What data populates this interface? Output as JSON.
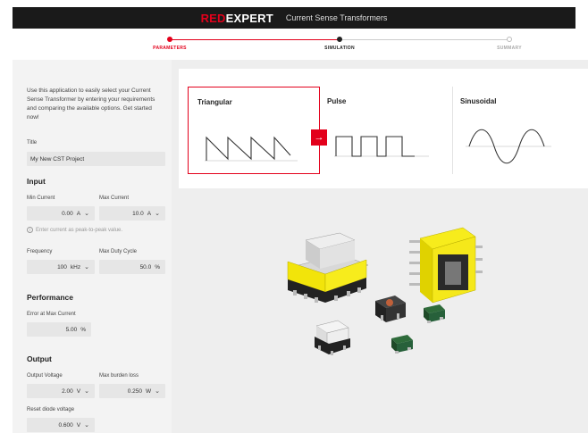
{
  "header": {
    "brand_red": "RED",
    "brand_white": "EXPERT",
    "title": "Current Sense Transformers"
  },
  "steps": [
    {
      "label": "PARAMETERS",
      "state": "done"
    },
    {
      "label": "SIMULATION",
      "state": "active"
    },
    {
      "label": "SUMMARY",
      "state": "pending"
    }
  ],
  "sidebar": {
    "intro": "Use this application to easily select your Current Sense Transformer by entering your requirements and comparing the available options. Get started now!",
    "title_label": "Title",
    "title_value": "My New CST Project",
    "input_heading": "Input",
    "min_current_label": "Min Current",
    "min_current_value": "0.00",
    "min_current_unit": "A",
    "max_current_label": "Max Current",
    "max_current_value": "10.0",
    "max_current_unit": "A",
    "current_hint": "Enter current as peak-to-peak value.",
    "frequency_label": "Frequency",
    "frequency_value": "100",
    "frequency_unit": "kHz",
    "duty_label": "Max Duty Cycle",
    "duty_value": "50.0",
    "duty_unit": "%",
    "performance_heading": "Performance",
    "error_label": "Error at Max Current",
    "error_value": "5.00",
    "error_unit": "%",
    "output_heading": "Output",
    "voltage_label": "Output Voltage",
    "voltage_value": "2.00",
    "voltage_unit": "V",
    "burden_label": "Max burden loss",
    "burden_value": "0.250",
    "burden_unit": "W",
    "diode_label": "Reset diode voltage",
    "diode_value": "0.600",
    "diode_unit": "V"
  },
  "waveforms": [
    {
      "label": "Triangular",
      "selected": true
    },
    {
      "label": "Pulse",
      "selected": false
    },
    {
      "label": "Sinusoidal",
      "selected": false
    }
  ],
  "colors": {
    "accent": "#e3001b",
    "topbar": "#1a1a1a",
    "panel_bg": "#f3f3f3",
    "main_bg": "#eeeeee"
  }
}
